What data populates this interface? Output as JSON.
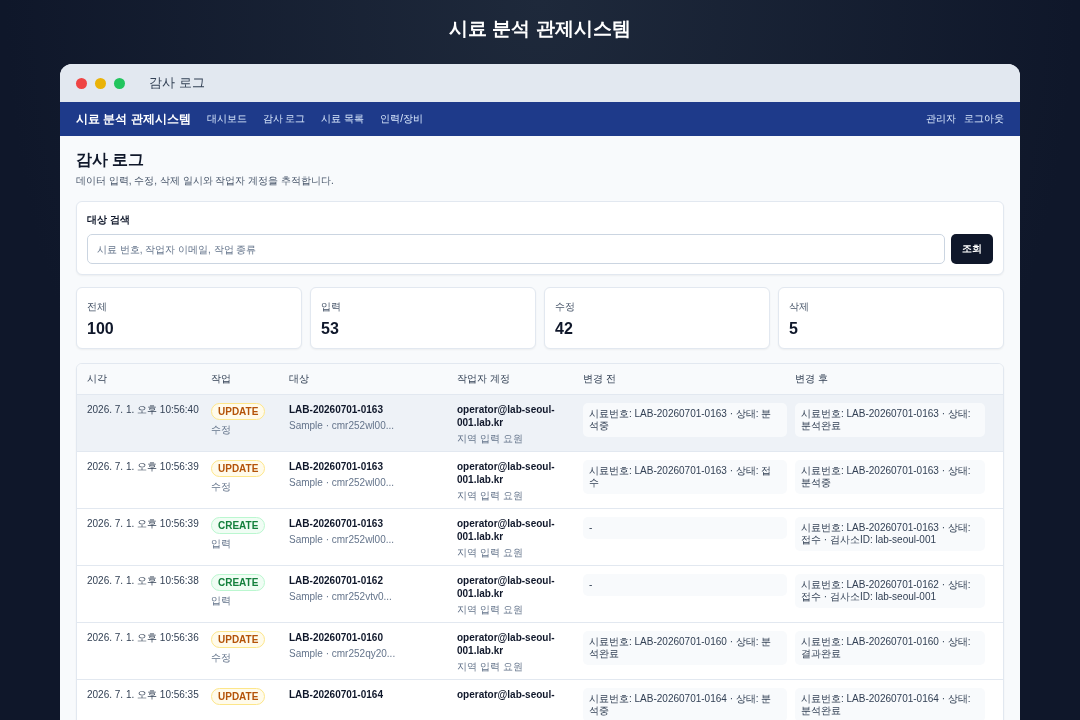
{
  "page_title": "시료 분석 관제시스템",
  "window": {
    "title": "감사 로그"
  },
  "navbar": {
    "brand": "시료 분석 관제시스템",
    "links": [
      "대시보드",
      "감사 로그",
      "시료 목록",
      "인력/장비"
    ],
    "user": "관리자",
    "logout": "로그아웃"
  },
  "header": {
    "title": "감사 로그",
    "subtitle": "데이터 입력, 수정, 삭제 일시와 작업자 계정을 추적합니다."
  },
  "search": {
    "label": "대상 검색",
    "placeholder": "시료 번호, 작업자 이메일, 작업 종류",
    "button": "조회"
  },
  "stats": [
    {
      "label": "전체",
      "value": "100"
    },
    {
      "label": "입력",
      "value": "53"
    },
    {
      "label": "수정",
      "value": "42"
    },
    {
      "label": "삭제",
      "value": "5"
    }
  ],
  "table": {
    "columns": [
      "시각",
      "작업",
      "대상",
      "작업자 계정",
      "변경 전",
      "변경 후"
    ],
    "rows": [
      {
        "selected": true,
        "time": "2026. 7. 1. 오후 10:56:40",
        "action": "UPDATE",
        "kind": "update",
        "action_label": "수정",
        "target": "LAB-20260701-0163",
        "target_sub": "Sample · cmr252wl00...",
        "account": "operator@lab-seoul-001.lab.kr",
        "role": "지역 입력 요원",
        "before": "시료번호: LAB-20260701-0163 · 상태: 분석중",
        "after": "시료번호: LAB-20260701-0163 · 상태: 분석완료"
      },
      {
        "selected": false,
        "time": "2026. 7. 1. 오후 10:56:39",
        "action": "UPDATE",
        "kind": "update",
        "action_label": "수정",
        "target": "LAB-20260701-0163",
        "target_sub": "Sample · cmr252wl00...",
        "account": "operator@lab-seoul-001.lab.kr",
        "role": "지역 입력 요원",
        "before": "시료번호: LAB-20260701-0163 · 상태: 접수",
        "after": "시료번호: LAB-20260701-0163 · 상태: 분석중"
      },
      {
        "selected": false,
        "time": "2026. 7. 1. 오후 10:56:39",
        "action": "CREATE",
        "kind": "create",
        "action_label": "입력",
        "target": "LAB-20260701-0163",
        "target_sub": "Sample · cmr252wl00...",
        "account": "operator@lab-seoul-001.lab.kr",
        "role": "지역 입력 요원",
        "before": "-",
        "after": "시료번호: LAB-20260701-0163 · 상태: 접수 · 검사소ID: lab-seoul-001"
      },
      {
        "selected": false,
        "time": "2026. 7. 1. 오후 10:56:38",
        "action": "CREATE",
        "kind": "create",
        "action_label": "입력",
        "target": "LAB-20260701-0162",
        "target_sub": "Sample · cmr252vtv0...",
        "account": "operator@lab-seoul-001.lab.kr",
        "role": "지역 입력 요원",
        "before": "-",
        "after": "시료번호: LAB-20260701-0162 · 상태: 접수 · 검사소ID: lab-seoul-001"
      },
      {
        "selected": false,
        "time": "2026. 7. 1. 오후 10:56:36",
        "action": "UPDATE",
        "kind": "update",
        "action_label": "수정",
        "target": "LAB-20260701-0160",
        "target_sub": "Sample · cmr252qy20...",
        "account": "operator@lab-seoul-001.lab.kr",
        "role": "지역 입력 요원",
        "before": "시료번호: LAB-20260701-0160 · 상태: 분석완료",
        "after": "시료번호: LAB-20260701-0160 · 상태: 결과완료"
      },
      {
        "selected": false,
        "time": "2026. 7. 1. 오후 10:56:35",
        "action": "UPDATE",
        "kind": "update",
        "target": "LAB-20260701-0164",
        "account": "operator@lab-seoul-",
        "before": "시료번호: LAB-20260701-0164 · 상태: 분석중",
        "after": "시료번호: LAB-20260701-0164 · 상태: 분석완료"
      }
    ]
  }
}
